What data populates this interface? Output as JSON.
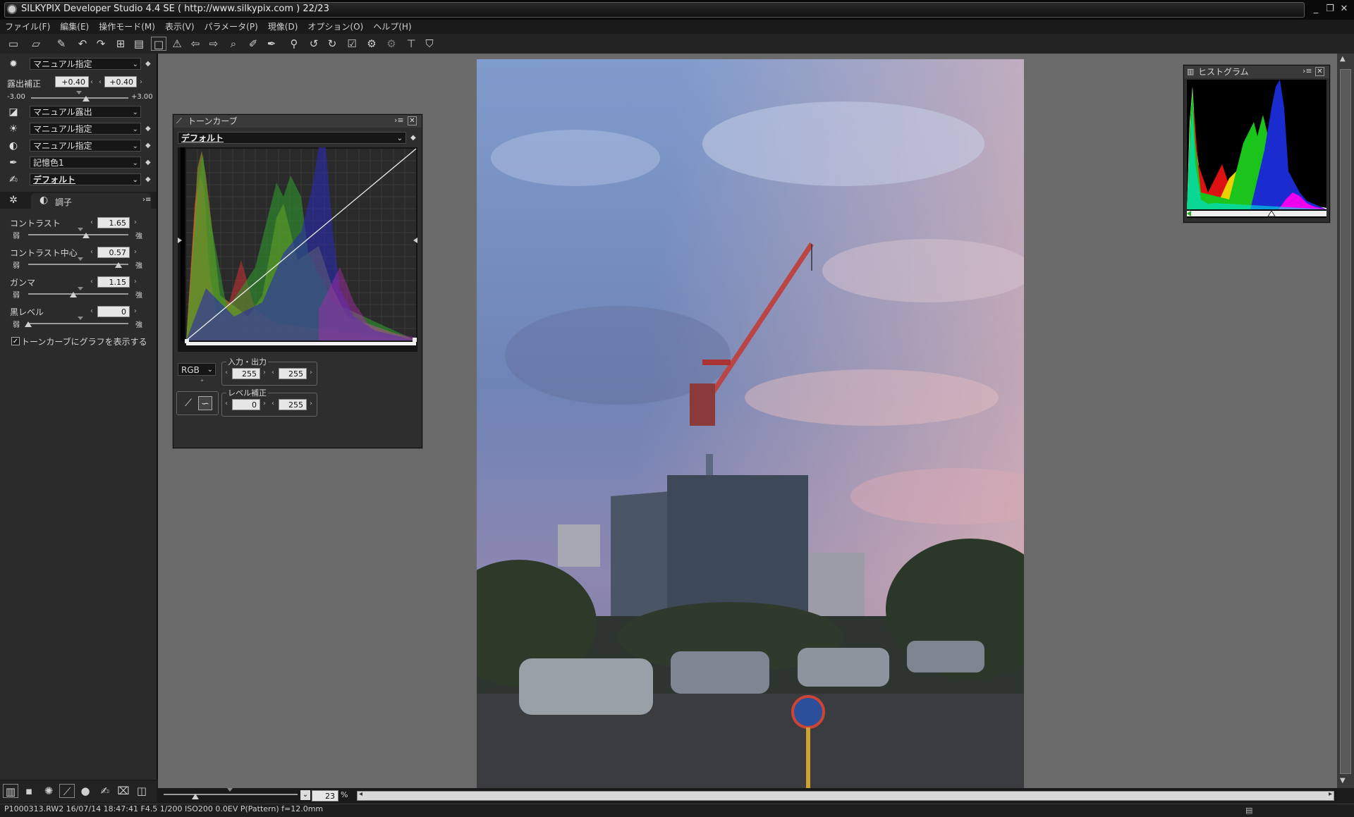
{
  "window": {
    "title": "SILKYPIX Developer Studio 4.4 SE ( http://www.silkypix.com )  22/23",
    "minimize": "_",
    "restore": "❐",
    "close": "✕"
  },
  "menu": [
    "ファイル(F)",
    "編集(E)",
    "操作モード(M)",
    "表示(V)",
    "パラメータ(P)",
    "現像(D)",
    "オプション(O)",
    "ヘルプ(H)"
  ],
  "toolbar_icons": [
    "open-icon",
    "open-folder-icon",
    "eraser-icon",
    "undo-icon",
    "redo-icon",
    "grid-view-icon",
    "filmstrip-view-icon",
    "single-view-icon",
    "warning-icon",
    "prev-icon",
    "next-icon",
    "zoom-icon",
    "wb-picker-icon",
    "picker-icon",
    "eyedropper-icon",
    "rotate-left-icon",
    "rotate-right-icon",
    "check-icon",
    "develop-icon",
    "develop-batch-icon",
    "tool-icon",
    "shield-icon"
  ],
  "left_panel": {
    "wb_select": "マニュアル指定",
    "exposure_label": "露出補正",
    "exposure_value_left": "+0.40",
    "exposure_value_right": "+0.40",
    "exposure_min": "-3.00",
    "exposure_max": "+3.00",
    "exposure_fraction": 0.567,
    "tone_select": "マニュアル露出",
    "light_select": "マニュアル指定",
    "contrast_select": "マニュアル指定",
    "color_select": "記憶色1",
    "style_select": "デフォルト",
    "tab_label": "調子",
    "sliders": [
      {
        "label": "コントラスト",
        "value": "1.65",
        "weak": "弱",
        "strong": "強",
        "fraction": 0.58
      },
      {
        "label": "コントラスト中心",
        "value": "0.57",
        "weak": "弱",
        "strong": "強",
        "fraction": 0.9
      },
      {
        "label": "ガンマ",
        "value": "1.15",
        "weak": "弱",
        "strong": "強",
        "fraction": 0.45
      },
      {
        "label": "黒レベル",
        "value": "0",
        "weak": "弱",
        "strong": "強",
        "fraction": 0.0
      }
    ],
    "checkbox_label": "トーンカーブにグラフを表示する",
    "checkbox_checked": true
  },
  "tone_curve": {
    "title": "トーンカーブ",
    "preset": "デフォルト",
    "channel": "RGB",
    "io_label": "入力・出力",
    "input_value": "255",
    "output_value": "255",
    "level_label": "レベル補正",
    "level_low": "0",
    "level_high": "255"
  },
  "histogram": {
    "title": "ヒストグラム"
  },
  "zoom": {
    "value": "23",
    "unit": "%"
  },
  "status": "P1000313.RW2 16/07/14 18:47:41 F4.5 1/200 ISO200  0.0EV P(Pattern) f=12.0mm"
}
